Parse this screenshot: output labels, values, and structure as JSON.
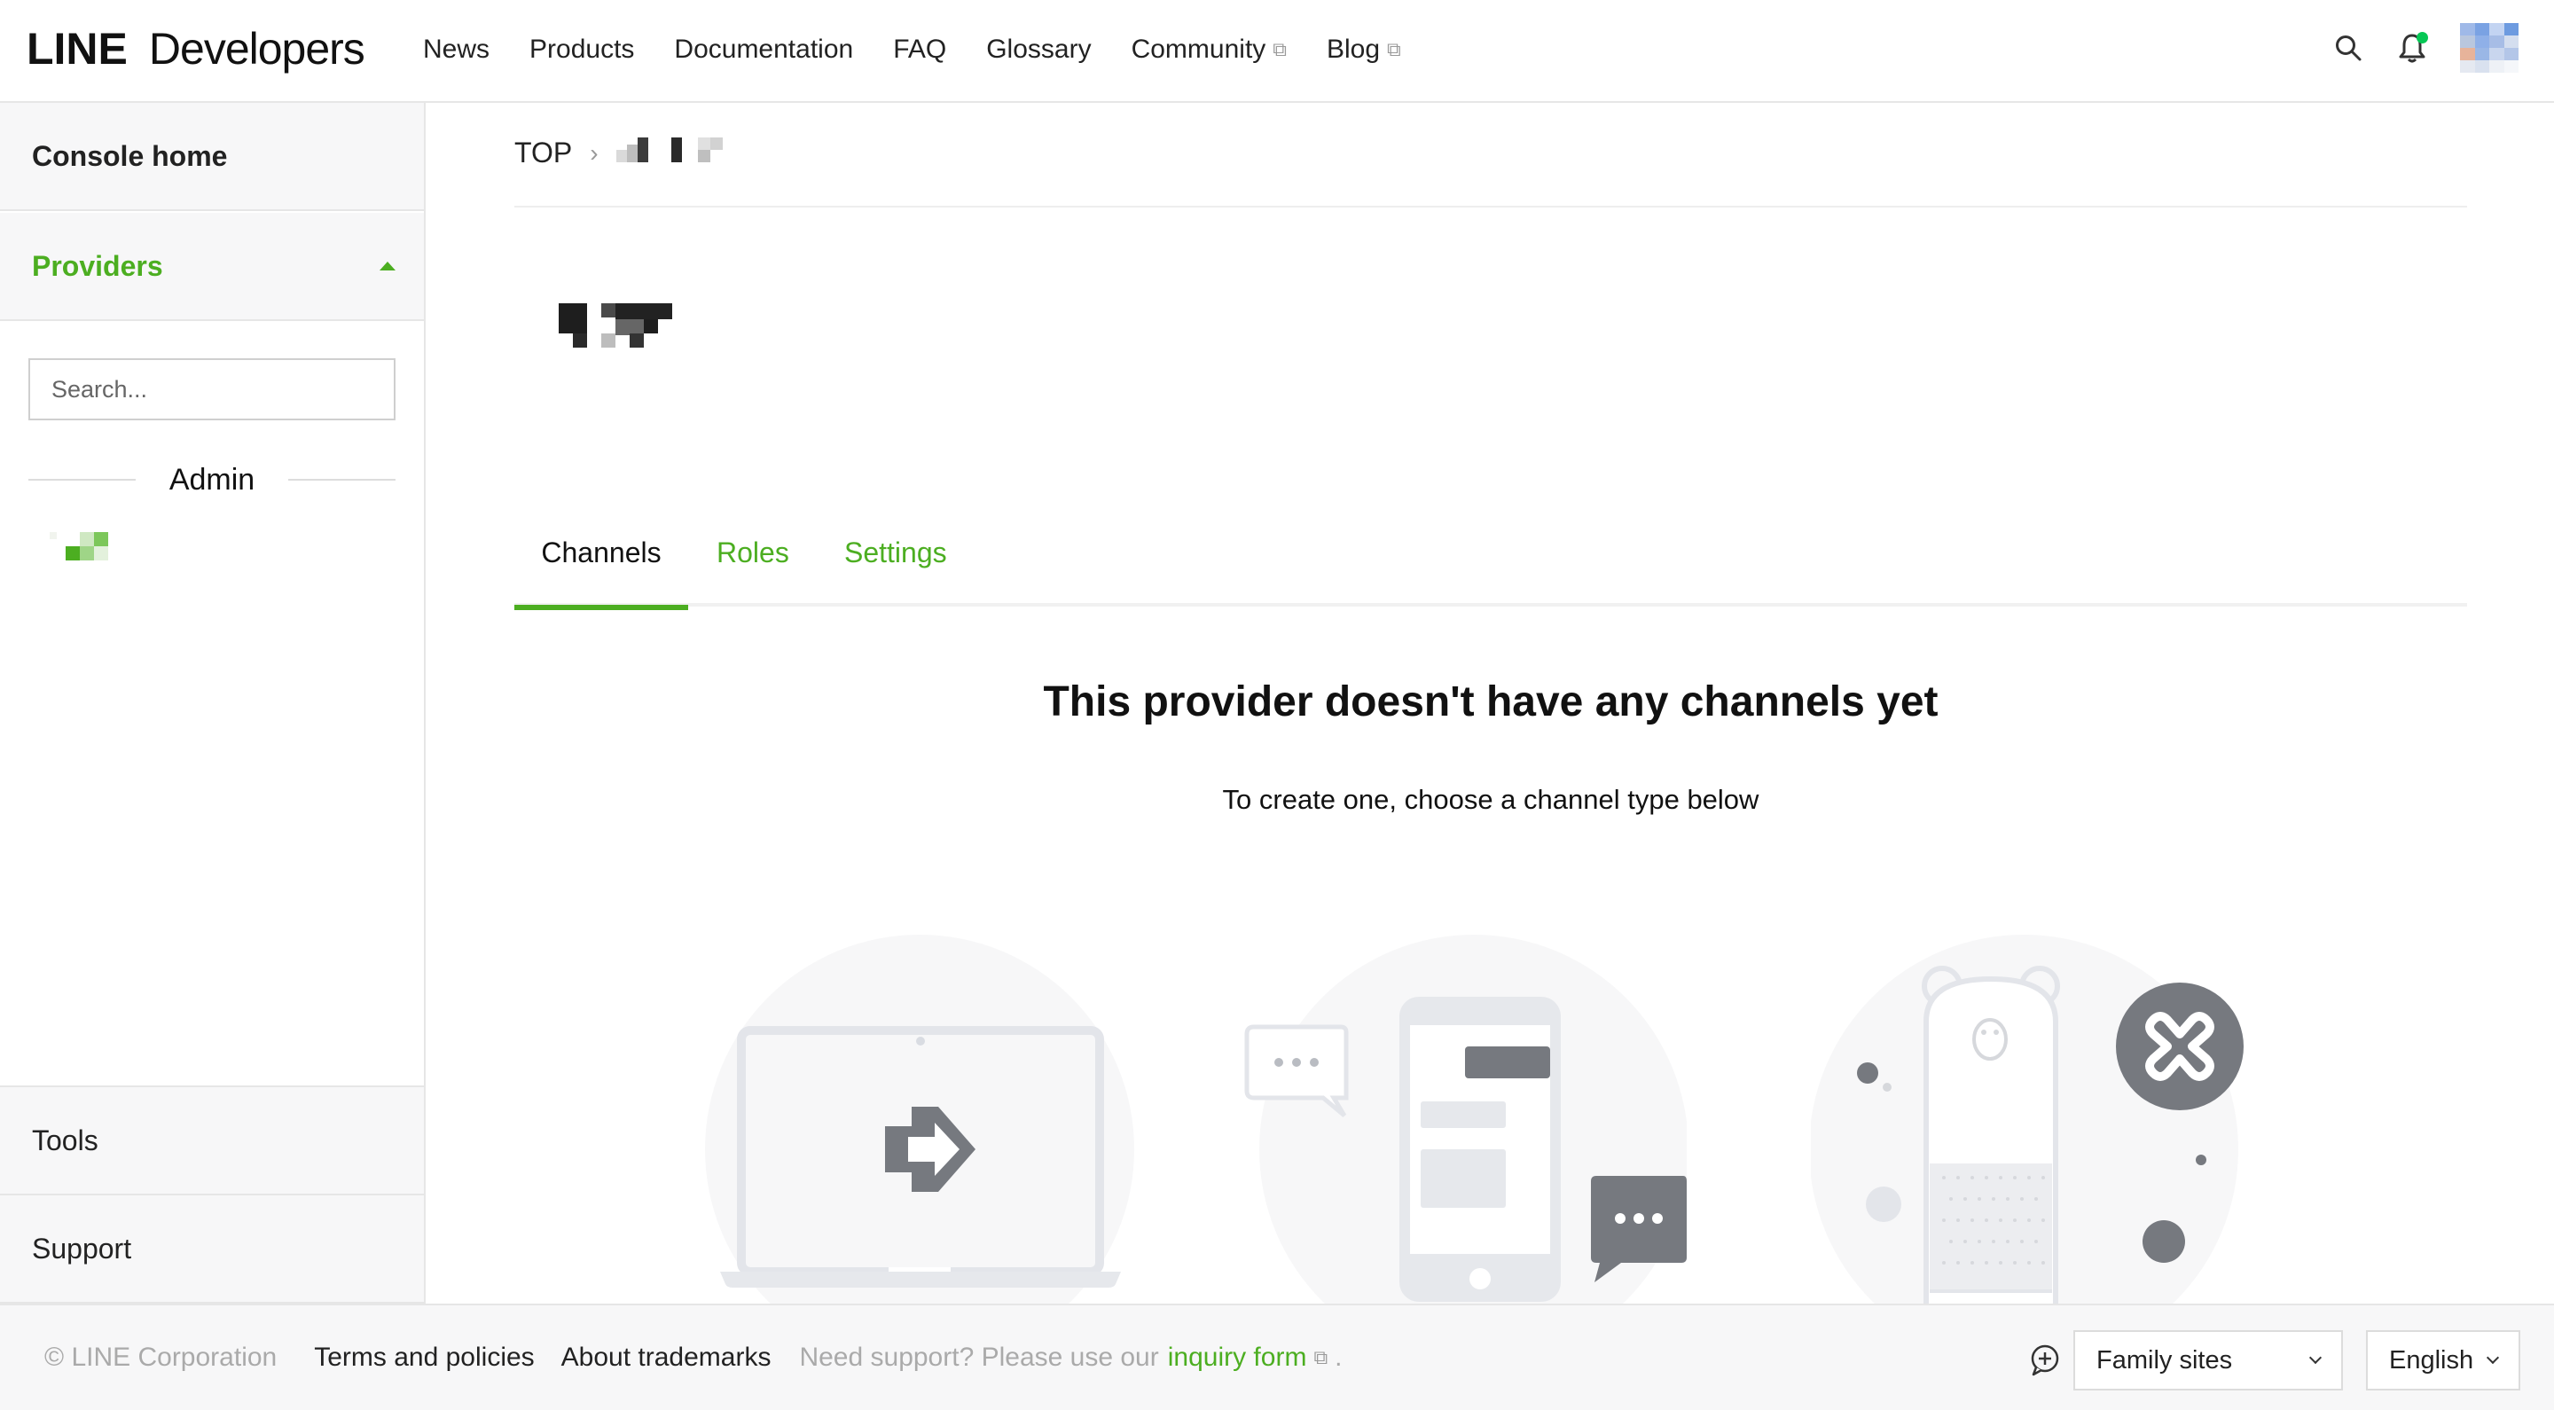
{
  "header": {
    "logo_bold": "LINE",
    "logo_light": "Developers",
    "nav": [
      {
        "label": "News"
      },
      {
        "label": "Products"
      },
      {
        "label": "Documentation"
      },
      {
        "label": "FAQ"
      },
      {
        "label": "Glossary"
      },
      {
        "label": "Community"
      },
      {
        "label": "Blog"
      }
    ],
    "icons": [
      "search-icon",
      "bell-icon",
      "avatar"
    ]
  },
  "sidebar": {
    "console_home": "Console home",
    "providers": "Providers",
    "search_placeholder": "Search...",
    "admin_heading": "Admin",
    "tools": "Tools",
    "support": "Support"
  },
  "main": {
    "breadcrumb_top": "TOP",
    "tabs": [
      {
        "label": "Channels",
        "active": true
      },
      {
        "label": "Roles"
      },
      {
        "label": "Settings"
      }
    ],
    "empty_title": "This provider doesn't have any channels yet",
    "empty_subtitle": "To create one, choose a channel type below"
  },
  "footer": {
    "copyright": "© LINE Corporation",
    "terms": "Terms and policies",
    "trademarks": "About trademarks",
    "support_text": "Need support? Please use our",
    "inquiry_link": "inquiry form",
    "period": ".",
    "family_sites": "Family sites",
    "language": "English"
  },
  "colors": {
    "accent": "#4cae21",
    "status_dot": "#06c755",
    "illustration_gray": "#76797f"
  }
}
